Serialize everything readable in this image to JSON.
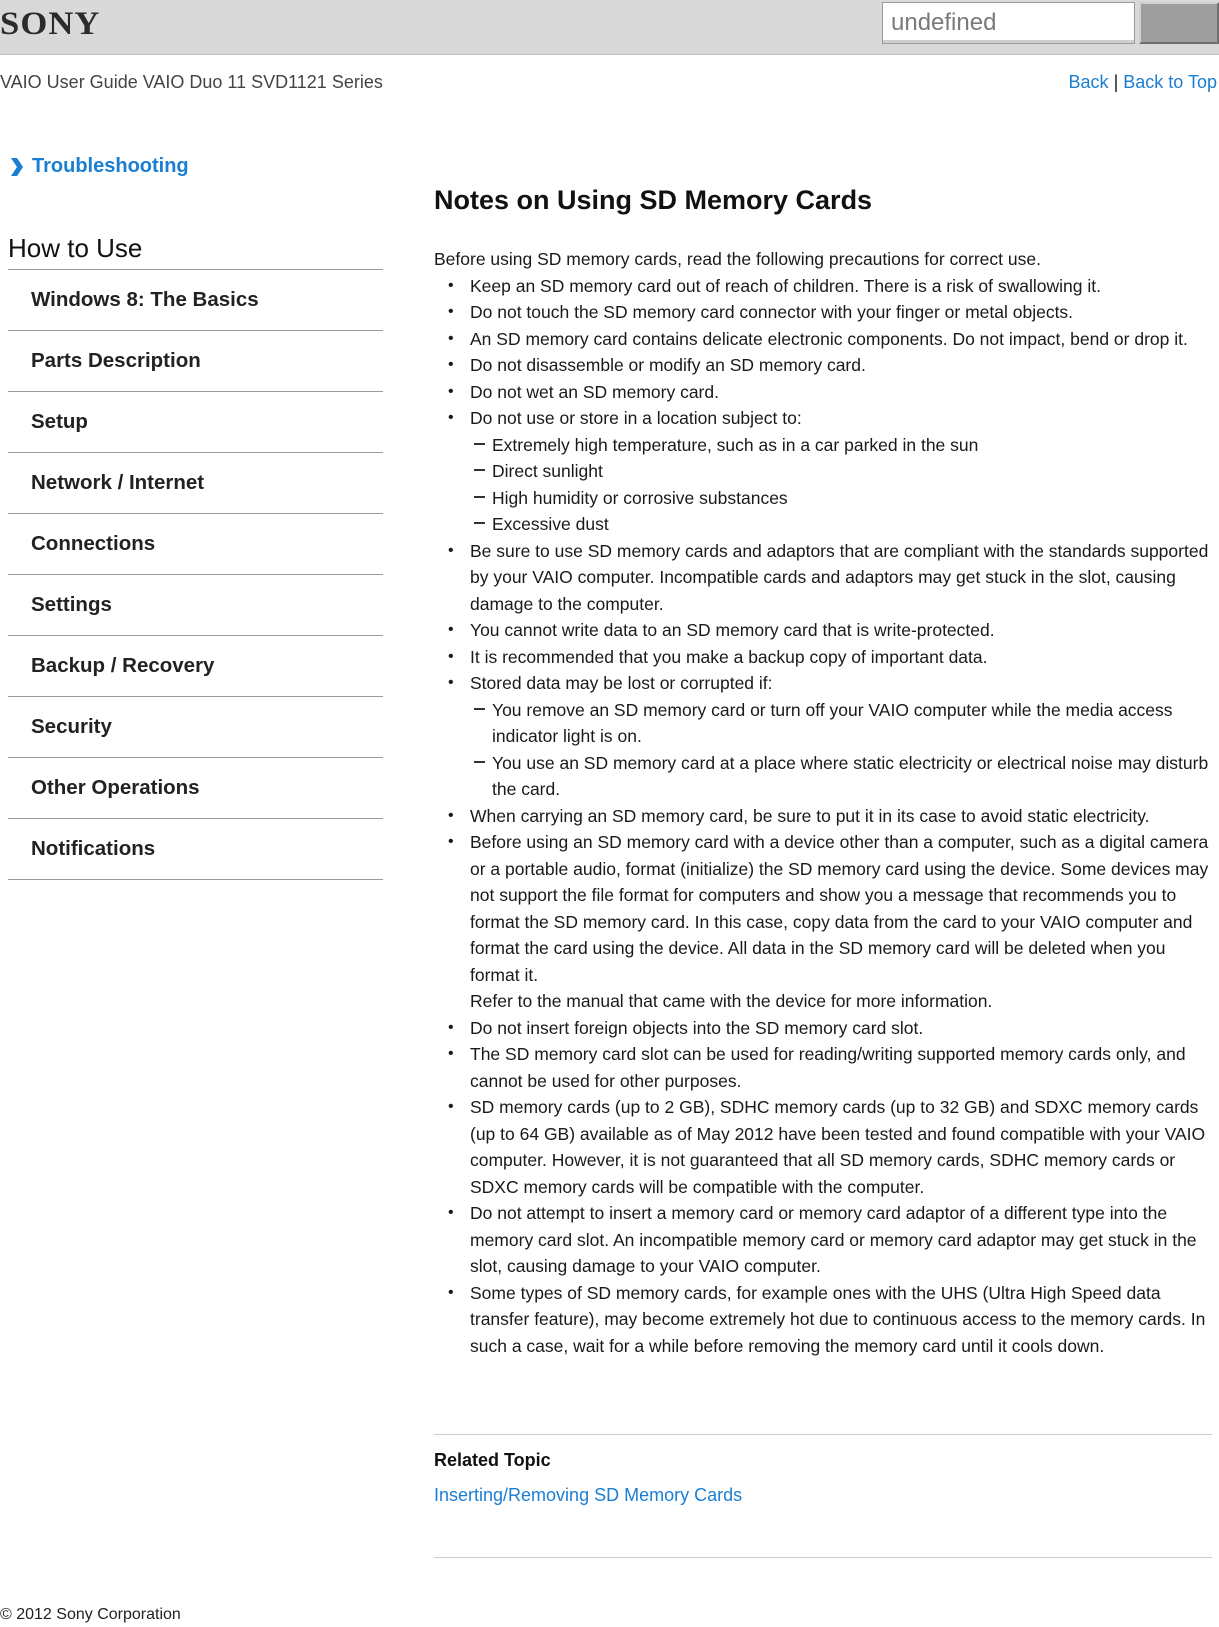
{
  "header": {
    "logo": "SONY",
    "search_value": "undefined",
    "search_button_label": ""
  },
  "nav": {
    "guide_title": "VAIO User Guide VAIO Duo 11 SVD1121 Series",
    "back_label": "Back",
    "separator": "|",
    "back_to_top_label": "Back to Top"
  },
  "sidebar": {
    "troubleshooting_label": "Troubleshooting",
    "section_title": "How to Use",
    "items": [
      {
        "label": "Windows 8: The Basics"
      },
      {
        "label": "Parts Description"
      },
      {
        "label": "Setup"
      },
      {
        "label": "Network / Internet"
      },
      {
        "label": "Connections"
      },
      {
        "label": "Settings"
      },
      {
        "label": "Backup / Recovery"
      },
      {
        "label": "Security"
      },
      {
        "label": "Other Operations"
      },
      {
        "label": "Notifications"
      }
    ]
  },
  "article": {
    "title": "Notes on Using SD Memory Cards",
    "intro": "Before using SD memory cards, read the following precautions for correct use.",
    "bullets": [
      {
        "text": "Keep an SD memory card out of reach of children. There is a risk of swallowing it."
      },
      {
        "text": "Do not touch the SD memory card connector with your finger or metal objects."
      },
      {
        "text": "An SD memory card contains delicate electronic components. Do not impact, bend or drop it."
      },
      {
        "text": "Do not disassemble or modify an SD memory card."
      },
      {
        "text": "Do not wet an SD memory card."
      },
      {
        "text": "Do not use or store in a location subject to:",
        "sub": [
          "Extremely high temperature, such as in a car parked in the sun",
          "Direct sunlight",
          "High humidity or corrosive substances",
          "Excessive dust"
        ]
      },
      {
        "text": "Be sure to use SD memory cards and adaptors that are compliant with the standards supported by your VAIO computer. Incompatible cards and adaptors may get stuck in the slot, causing damage to the computer."
      },
      {
        "text": "You cannot write data to an SD memory card that is write-protected."
      },
      {
        "text": "It is recommended that you make a backup copy of important data."
      },
      {
        "text": "Stored data may be lost or corrupted if:",
        "sub": [
          "You remove an SD memory card or turn off your VAIO computer while the media access indicator light is on.",
          "You use an SD memory card at a place where static electricity or electrical noise may disturb the card."
        ]
      },
      {
        "text": "When carrying an SD memory card, be sure to put it in its case to avoid static electricity."
      },
      {
        "text": "Before using an SD memory card with a device other than a computer, such as a digital camera or a portable audio, format (initialize) the SD memory card using the device. Some devices may not support the file format for computers and show you a message that recommends you to format the SD memory card. In this case, copy data from the card to your VAIO computer and format the card using the device. All data in the SD memory card will be deleted when you format it.",
        "note": "Refer to the manual that came with the device for more information."
      },
      {
        "text": "Do not insert foreign objects into the SD memory card slot."
      },
      {
        "text": "The SD memory card slot can be used for reading/writing supported memory cards only, and cannot be used for other purposes."
      },
      {
        "text": "SD memory cards (up to 2 GB), SDHC memory cards (up to 32 GB) and SDXC memory cards (up to 64 GB) available as of May 2012 have been tested and found compatible with your VAIO computer. However, it is not guaranteed that all SD memory cards, SDHC memory cards or SDXC memory cards will be compatible with the computer."
      },
      {
        "text": "Do not attempt to insert a memory card or memory card adaptor of a different type into the memory card slot. An incompatible memory card or memory card adaptor may get stuck in the slot, causing damage to your VAIO computer."
      },
      {
        "text": "Some types of SD memory cards, for example ones with the UHS (Ultra High Speed data transfer feature), may become extremely hot due to continuous access to the memory cards. In such a case, wait for a while before removing the memory card until it cools down."
      }
    ]
  },
  "related": {
    "heading": "Related Topic",
    "links": [
      "Inserting/Removing SD Memory Cards"
    ]
  },
  "footer": {
    "copyright": "© 2012 Sony Corporation"
  },
  "colors": {
    "link": "#1a7ed3",
    "header_bg": "#d9d9d9"
  }
}
